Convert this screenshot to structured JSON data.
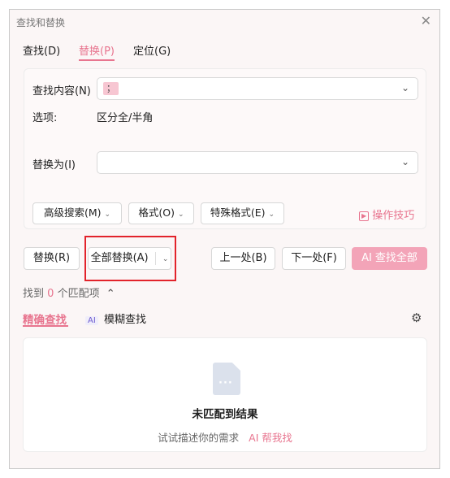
{
  "window": {
    "title": "查找和替换"
  },
  "tabs": [
    {
      "label": "查找(D)"
    },
    {
      "label": "替换(P)"
    },
    {
      "label": "定位(G)"
    }
  ],
  "find": {
    "label": "查找内容(N)",
    "value": "；"
  },
  "options": {
    "label": "选项:",
    "value": "区分全/半角"
  },
  "replace": {
    "label": "替换为(I)",
    "value": ""
  },
  "filters": {
    "advanced": "高级搜索(M)",
    "format": "格式(O)",
    "special": "特殊格式(E)",
    "tips": "操作技巧"
  },
  "actions": {
    "replace": "替换(R)",
    "replace_all": "全部替换(A)",
    "prev": "上一处(B)",
    "next": "下一处(F)",
    "ai_find_all": "AI 查找全部"
  },
  "match": {
    "prefix": "找到",
    "count": "0",
    "suffix": "个匹配项"
  },
  "modes": {
    "exact": "精确查找",
    "ai_badge": "AI",
    "fuzzy": "模糊查找"
  },
  "empty": {
    "title": "未匹配到结果",
    "hint": "试试描述你的需求",
    "ai_help": "AI 帮我找"
  },
  "colors": {
    "accent": "#e8758f",
    "highlight": "#e2232b"
  }
}
